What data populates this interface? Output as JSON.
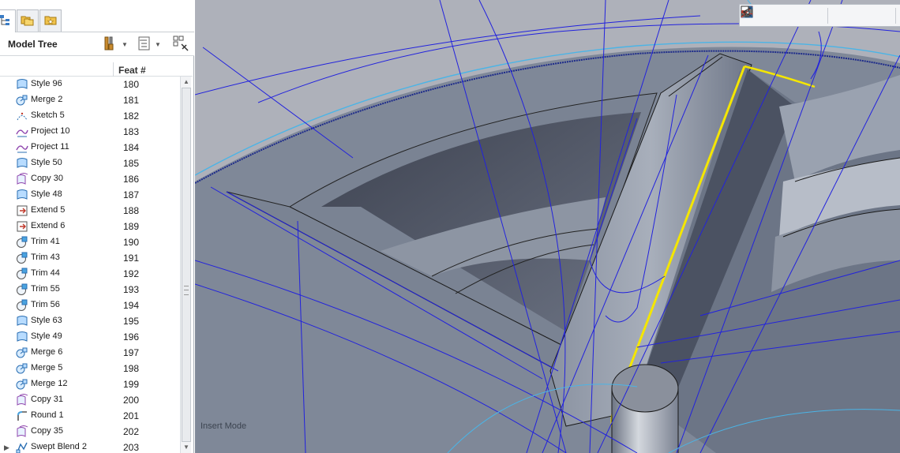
{
  "panel": {
    "tabs": [
      {
        "name": "model-tree-tab",
        "icon": "model-tree-icon"
      },
      {
        "name": "folder-browser-tab",
        "icon": "folders-icon"
      },
      {
        "name": "favorites-tab",
        "icon": "favorites-icon"
      }
    ],
    "title": "Model Tree",
    "header_buttons": [
      "tree-settings-icon",
      "show-icon",
      "columns-filter-icon"
    ],
    "column_header": "Feat #",
    "rows": [
      {
        "label": "Style 96",
        "feat": "180",
        "icon": "style-icon"
      },
      {
        "label": "Merge 2",
        "feat": "181",
        "icon": "merge-icon"
      },
      {
        "label": "Sketch 5",
        "feat": "182",
        "icon": "sketch-icon"
      },
      {
        "label": "Project 10",
        "feat": "183",
        "icon": "project-icon"
      },
      {
        "label": "Project 11",
        "feat": "184",
        "icon": "project-icon"
      },
      {
        "label": "Style 50",
        "feat": "185",
        "icon": "style-icon"
      },
      {
        "label": "Copy 30",
        "feat": "186",
        "icon": "copy-icon"
      },
      {
        "label": "Style 48",
        "feat": "187",
        "icon": "style-icon"
      },
      {
        "label": "Extend 5",
        "feat": "188",
        "icon": "extend-icon"
      },
      {
        "label": "Extend 6",
        "feat": "189",
        "icon": "extend-icon"
      },
      {
        "label": "Trim 41",
        "feat": "190",
        "icon": "trim-icon"
      },
      {
        "label": "Trim 43",
        "feat": "191",
        "icon": "trim-icon"
      },
      {
        "label": "Trim 44",
        "feat": "192",
        "icon": "trim-icon"
      },
      {
        "label": "Trim 55",
        "feat": "193",
        "icon": "trim-icon"
      },
      {
        "label": "Trim 56",
        "feat": "194",
        "icon": "trim-icon"
      },
      {
        "label": "Style 63",
        "feat": "195",
        "icon": "style-icon"
      },
      {
        "label": "Style 49",
        "feat": "196",
        "icon": "style-icon"
      },
      {
        "label": "Merge 6",
        "feat": "197",
        "icon": "merge-icon"
      },
      {
        "label": "Merge 5",
        "feat": "198",
        "icon": "merge-icon"
      },
      {
        "label": "Merge 12",
        "feat": "199",
        "icon": "merge-icon"
      },
      {
        "label": "Copy 31",
        "feat": "200",
        "icon": "copy-icon"
      },
      {
        "label": "Round 1",
        "feat": "201",
        "icon": "round-icon"
      },
      {
        "label": "Copy 35",
        "feat": "202",
        "icon": "copy-icon"
      },
      {
        "label": "Swept Blend 2",
        "feat": "203",
        "icon": "swept-blend-icon",
        "expandable": true
      }
    ]
  },
  "graphics_toolbar": [
    "refit-icon",
    "zoom-in-icon",
    "zoom-out-icon",
    "repaint-icon",
    "display-style-icon",
    "saved-views-icon",
    "view-manager-icon",
    "datum-display-icon",
    "annotation-display-icon",
    "spin-center-icon"
  ],
  "status": {
    "mode_text": "Insert Mode"
  },
  "colors": {
    "viewport_bg": "#a9b0bd",
    "model_surface": "#7e8797",
    "curve_blue": "#2222dd",
    "highlight_yellow": "#f4e600",
    "selected_edge": "#ffff00"
  }
}
